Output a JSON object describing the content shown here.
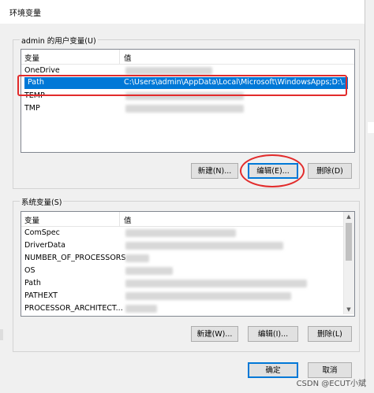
{
  "window": {
    "title": "环境变量"
  },
  "user_vars": {
    "group_label": "admin 的用户变量(U)",
    "headers": {
      "name": "变量",
      "value": "值"
    },
    "rows": [
      {
        "name": "OneDrive",
        "value": ""
      },
      {
        "name": "Path",
        "value": "C:\\Users\\admin\\AppData\\Local\\Microsoft\\WindowsApps;D:\\..."
      },
      {
        "name": "TEMP",
        "value": ""
      },
      {
        "name": "TMP",
        "value": ""
      }
    ],
    "buttons": {
      "new": "新建(N)...",
      "edit": "编辑(E)...",
      "delete": "删除(D)"
    }
  },
  "system_vars": {
    "group_label": "系统变量(S)",
    "headers": {
      "name": "变量",
      "value": "值"
    },
    "rows": [
      {
        "name": "ComSpec"
      },
      {
        "name": "DriverData"
      },
      {
        "name": "NUMBER_OF_PROCESSORS"
      },
      {
        "name": "OS"
      },
      {
        "name": "Path"
      },
      {
        "name": "PATHEXT"
      },
      {
        "name": "PROCESSOR_ARCHITECT..."
      }
    ],
    "buttons": {
      "new": "新建(W)...",
      "edit": "编辑(I)...",
      "delete": "删除(L)"
    }
  },
  "footer": {
    "ok": "确定",
    "cancel": "取消"
  },
  "watermark": "CSDN @ECUT小斌",
  "colors": {
    "selection": "#0078d7",
    "annotation": "#e22b2b"
  }
}
